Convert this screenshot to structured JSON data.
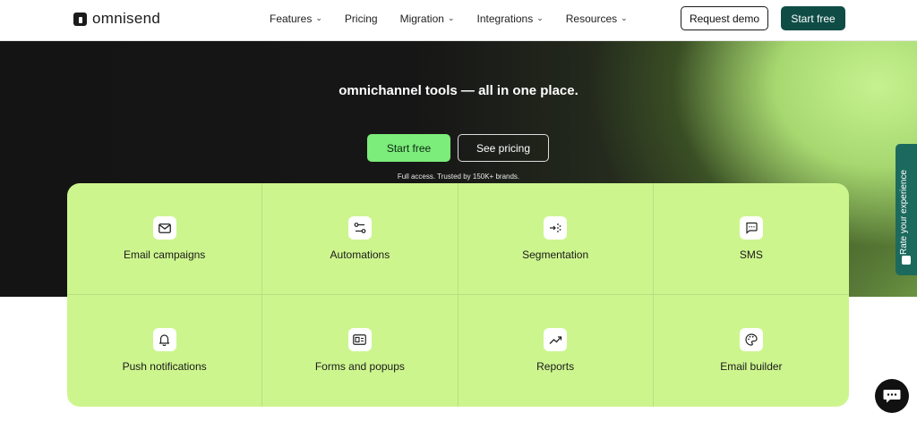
{
  "nav": {
    "logo_text": "omnisend",
    "menu": [
      {
        "label": "Features",
        "has_dropdown": true
      },
      {
        "label": "Pricing",
        "has_dropdown": false
      },
      {
        "label": "Migration",
        "has_dropdown": true
      },
      {
        "label": "Integrations",
        "has_dropdown": true
      },
      {
        "label": "Resources",
        "has_dropdown": true
      }
    ],
    "request_demo_label": "Request demo",
    "start_free_label": "Start free"
  },
  "hero": {
    "tagline": "omnichannel tools — all in one place.",
    "start_free_label": "Start free",
    "see_pricing_label": "See pricing",
    "trusted_text": "Full access. Trusted by 150K+ brands."
  },
  "features": [
    {
      "label": "Email campaigns",
      "icon": "mail-icon"
    },
    {
      "label": "Automations",
      "icon": "automation-icon"
    },
    {
      "label": "Segmentation",
      "icon": "segmentation-icon"
    },
    {
      "label": "SMS",
      "icon": "sms-icon"
    },
    {
      "label": "Push notifications",
      "icon": "bell-icon"
    },
    {
      "label": "Forms and popups",
      "icon": "form-icon"
    },
    {
      "label": "Reports",
      "icon": "trend-icon"
    },
    {
      "label": "Email builder",
      "icon": "palette-icon"
    }
  ],
  "feedback_tab": {
    "label": "Rate your experience"
  },
  "colors": {
    "nav_start_bg": "#0f4c45",
    "hero_start_bg": "#7cec7a",
    "feature_panel_bg": "#cdf58e",
    "feedback_tab_bg": "#1c6a5e"
  }
}
